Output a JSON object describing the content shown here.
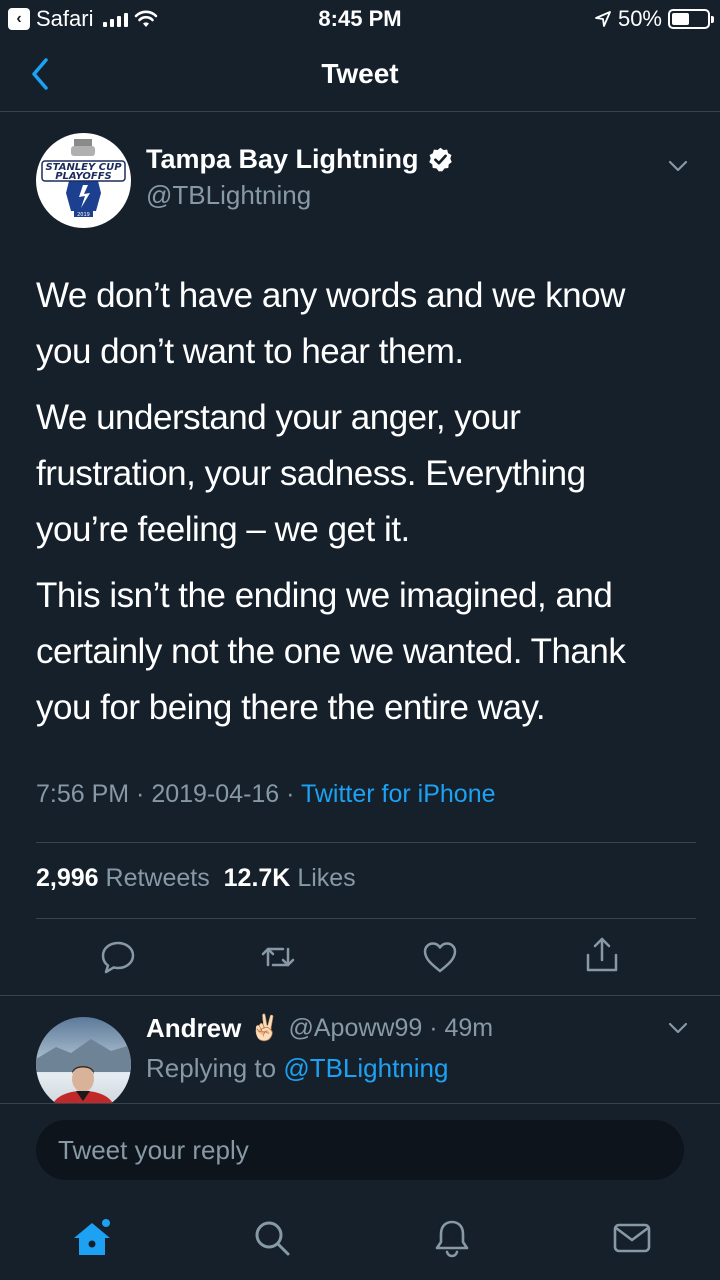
{
  "status_bar": {
    "back_app": "Safari",
    "time": "8:45 PM",
    "battery_percent": "50%",
    "battery_level": 0.5
  },
  "nav": {
    "title": "Tweet",
    "back_icon": "chevron-left-icon"
  },
  "tweet": {
    "author_name": "Tampa Bay Lightning",
    "author_handle": "@TBLightning",
    "avatar_text": [
      "STANLEY CUP",
      "PLAYOFFS",
      "2019"
    ],
    "paragraphs": [
      "We don’t have any words and we know you don’t want to hear them.",
      "We understand your anger, your frustration, your sadness. Everything you’re feeling – we get it.",
      "This isn’t the ending we imagined, and certainly not the one we wanted. Thank you for being there the entire way."
    ],
    "time": "7:56 PM",
    "date": "2019-04-16",
    "separator": " · ",
    "source": "Twitter for iPhone",
    "retweets_count": "2,996",
    "retweets_label": "Retweets",
    "likes_count": "12.7K",
    "likes_label": "Likes"
  },
  "reply": {
    "name": "Andrew",
    "emoji": "✌🏻",
    "handle": "@Apoww99",
    "age": "49m",
    "replying_prefix": "Replying to",
    "replying_to": "@TBLightning"
  },
  "composer": {
    "placeholder": "Tweet your reply"
  },
  "colors": {
    "background": "#15202b",
    "accent": "#1da1f2",
    "secondary_text": "#8899a6"
  }
}
